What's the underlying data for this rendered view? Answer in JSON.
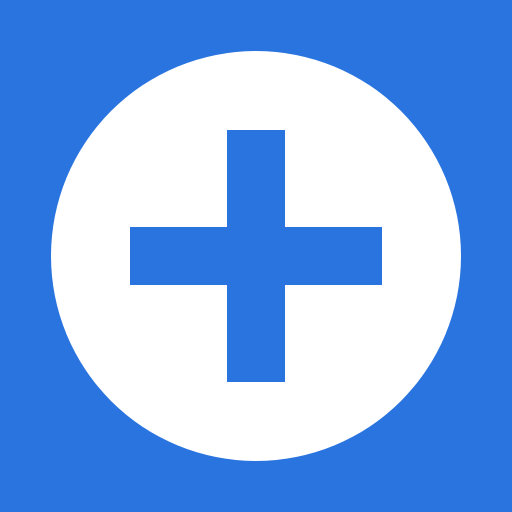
{
  "icon": {
    "name": "add-icon",
    "glyph": "plus",
    "background_color": "#2a74e0",
    "disc_color": "#ffffff",
    "plus_color": "#2a74e0"
  }
}
